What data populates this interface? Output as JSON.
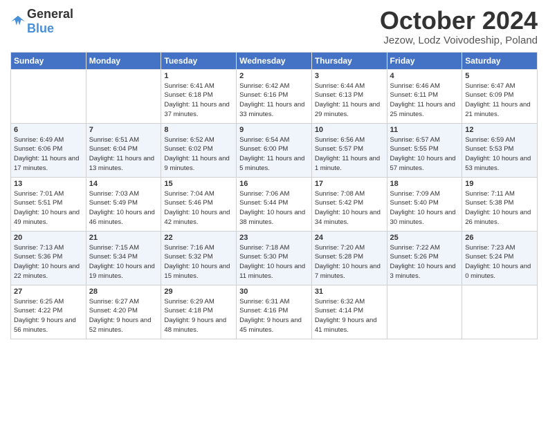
{
  "logo": {
    "text_general": "General",
    "text_blue": "Blue"
  },
  "header": {
    "month": "October 2024",
    "location": "Jezow, Lodz Voivodeship, Poland"
  },
  "weekdays": [
    "Sunday",
    "Monday",
    "Tuesday",
    "Wednesday",
    "Thursday",
    "Friday",
    "Saturday"
  ],
  "weeks": [
    [
      {
        "day": "",
        "info": ""
      },
      {
        "day": "",
        "info": ""
      },
      {
        "day": "1",
        "info": "Sunrise: 6:41 AM\nSunset: 6:18 PM\nDaylight: 11 hours and 37 minutes."
      },
      {
        "day": "2",
        "info": "Sunrise: 6:42 AM\nSunset: 6:16 PM\nDaylight: 11 hours and 33 minutes."
      },
      {
        "day": "3",
        "info": "Sunrise: 6:44 AM\nSunset: 6:13 PM\nDaylight: 11 hours and 29 minutes."
      },
      {
        "day": "4",
        "info": "Sunrise: 6:46 AM\nSunset: 6:11 PM\nDaylight: 11 hours and 25 minutes."
      },
      {
        "day": "5",
        "info": "Sunrise: 6:47 AM\nSunset: 6:09 PM\nDaylight: 11 hours and 21 minutes."
      }
    ],
    [
      {
        "day": "6",
        "info": "Sunrise: 6:49 AM\nSunset: 6:06 PM\nDaylight: 11 hours and 17 minutes."
      },
      {
        "day": "7",
        "info": "Sunrise: 6:51 AM\nSunset: 6:04 PM\nDaylight: 11 hours and 13 minutes."
      },
      {
        "day": "8",
        "info": "Sunrise: 6:52 AM\nSunset: 6:02 PM\nDaylight: 11 hours and 9 minutes."
      },
      {
        "day": "9",
        "info": "Sunrise: 6:54 AM\nSunset: 6:00 PM\nDaylight: 11 hours and 5 minutes."
      },
      {
        "day": "10",
        "info": "Sunrise: 6:56 AM\nSunset: 5:57 PM\nDaylight: 11 hours and 1 minute."
      },
      {
        "day": "11",
        "info": "Sunrise: 6:57 AM\nSunset: 5:55 PM\nDaylight: 10 hours and 57 minutes."
      },
      {
        "day": "12",
        "info": "Sunrise: 6:59 AM\nSunset: 5:53 PM\nDaylight: 10 hours and 53 minutes."
      }
    ],
    [
      {
        "day": "13",
        "info": "Sunrise: 7:01 AM\nSunset: 5:51 PM\nDaylight: 10 hours and 49 minutes."
      },
      {
        "day": "14",
        "info": "Sunrise: 7:03 AM\nSunset: 5:49 PM\nDaylight: 10 hours and 46 minutes."
      },
      {
        "day": "15",
        "info": "Sunrise: 7:04 AM\nSunset: 5:46 PM\nDaylight: 10 hours and 42 minutes."
      },
      {
        "day": "16",
        "info": "Sunrise: 7:06 AM\nSunset: 5:44 PM\nDaylight: 10 hours and 38 minutes."
      },
      {
        "day": "17",
        "info": "Sunrise: 7:08 AM\nSunset: 5:42 PM\nDaylight: 10 hours and 34 minutes."
      },
      {
        "day": "18",
        "info": "Sunrise: 7:09 AM\nSunset: 5:40 PM\nDaylight: 10 hours and 30 minutes."
      },
      {
        "day": "19",
        "info": "Sunrise: 7:11 AM\nSunset: 5:38 PM\nDaylight: 10 hours and 26 minutes."
      }
    ],
    [
      {
        "day": "20",
        "info": "Sunrise: 7:13 AM\nSunset: 5:36 PM\nDaylight: 10 hours and 22 minutes."
      },
      {
        "day": "21",
        "info": "Sunrise: 7:15 AM\nSunset: 5:34 PM\nDaylight: 10 hours and 19 minutes."
      },
      {
        "day": "22",
        "info": "Sunrise: 7:16 AM\nSunset: 5:32 PM\nDaylight: 10 hours and 15 minutes."
      },
      {
        "day": "23",
        "info": "Sunrise: 7:18 AM\nSunset: 5:30 PM\nDaylight: 10 hours and 11 minutes."
      },
      {
        "day": "24",
        "info": "Sunrise: 7:20 AM\nSunset: 5:28 PM\nDaylight: 10 hours and 7 minutes."
      },
      {
        "day": "25",
        "info": "Sunrise: 7:22 AM\nSunset: 5:26 PM\nDaylight: 10 hours and 3 minutes."
      },
      {
        "day": "26",
        "info": "Sunrise: 7:23 AM\nSunset: 5:24 PM\nDaylight: 10 hours and 0 minutes."
      }
    ],
    [
      {
        "day": "27",
        "info": "Sunrise: 6:25 AM\nSunset: 4:22 PM\nDaylight: 9 hours and 56 minutes."
      },
      {
        "day": "28",
        "info": "Sunrise: 6:27 AM\nSunset: 4:20 PM\nDaylight: 9 hours and 52 minutes."
      },
      {
        "day": "29",
        "info": "Sunrise: 6:29 AM\nSunset: 4:18 PM\nDaylight: 9 hours and 48 minutes."
      },
      {
        "day": "30",
        "info": "Sunrise: 6:31 AM\nSunset: 4:16 PM\nDaylight: 9 hours and 45 minutes."
      },
      {
        "day": "31",
        "info": "Sunrise: 6:32 AM\nSunset: 4:14 PM\nDaylight: 9 hours and 41 minutes."
      },
      {
        "day": "",
        "info": ""
      },
      {
        "day": "",
        "info": ""
      }
    ]
  ]
}
